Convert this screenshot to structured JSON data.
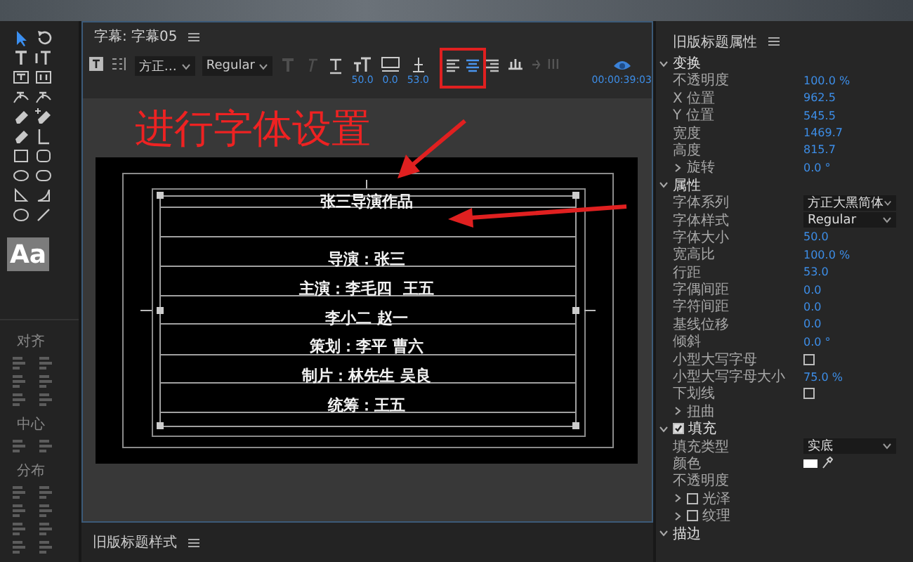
{
  "tools": [
    {
      "kind": "selection",
      "selected": true
    },
    {
      "kind": "rotation",
      "selected": false
    },
    {
      "kind": "type",
      "selected": false
    },
    {
      "kind": "vertical-type",
      "selected": false
    },
    {
      "kind": "area-type",
      "selected": false
    },
    {
      "kind": "vertical-area-type",
      "selected": false
    },
    {
      "kind": "path-type",
      "selected": false
    },
    {
      "kind": "vertical-path-type",
      "selected": false
    },
    {
      "kind": "pen",
      "selected": false
    },
    {
      "kind": "add-anchor",
      "selected": false
    },
    {
      "kind": "delete-anchor",
      "selected": false
    },
    {
      "kind": "convert-anchor",
      "selected": false
    },
    {
      "kind": "rectangle",
      "selected": false
    },
    {
      "kind": "rounded-rectangle",
      "selected": false
    },
    {
      "kind": "ellipse",
      "selected": false
    },
    {
      "kind": "rounded-ellipse",
      "selected": false
    },
    {
      "kind": "wedge",
      "selected": false
    },
    {
      "kind": "arc",
      "selected": false
    },
    {
      "kind": "circle",
      "selected": false
    },
    {
      "kind": "line",
      "selected": false
    }
  ],
  "style_preview": "Aa",
  "tool_sections": [
    {
      "label": "对齐"
    },
    {
      "label": "中心"
    },
    {
      "label": "分布"
    }
  ],
  "title_panel": {
    "title": "字幕: 字幕05",
    "toolbar": {
      "font_family": "方正…",
      "font_style": "Regular",
      "style_buttons": [
        {
          "kind": "bold",
          "disabled": true
        },
        {
          "kind": "italic",
          "disabled": true
        },
        {
          "kind": "underline",
          "disabled": false
        }
      ],
      "size": "50.0",
      "kerning": "0.0",
      "leading": "53.0",
      "alignment": [
        {
          "kind": "left",
          "selected": false
        },
        {
          "kind": "center",
          "selected": true
        },
        {
          "kind": "right",
          "selected": false
        }
      ],
      "timecode": "00:00:39:03"
    },
    "canvas": {
      "title_text": "张三导演作品",
      "credits": [
        "导演：张三",
        "主演：李毛四  王五",
        "李小二 赵一",
        "策划：李平 曹六",
        "制片：林先生 吴良",
        "统筹：王五"
      ]
    }
  },
  "styles_panel": {
    "title": "旧版标题样式"
  },
  "properties_panel": {
    "title": "旧版标题属性",
    "rows": [
      {
        "kind": "section",
        "label": "变换",
        "expanded": true
      },
      {
        "kind": "value",
        "label": "不透明度",
        "value": "100.0 %"
      },
      {
        "kind": "value",
        "label": "X 位置",
        "value": "962.5"
      },
      {
        "kind": "value",
        "label": "Y 位置",
        "value": "545.5"
      },
      {
        "kind": "value",
        "label": "宽度",
        "value": "1469.7"
      },
      {
        "kind": "value",
        "label": "高度",
        "value": "815.7"
      },
      {
        "kind": "group",
        "label": "旋转",
        "expanded": false,
        "value": "0.0 °"
      },
      {
        "kind": "section",
        "label": "属性",
        "expanded": true
      },
      {
        "kind": "dropdown",
        "label": "字体系列",
        "value": "方正大黑简体"
      },
      {
        "kind": "dropdown",
        "label": "字体样式",
        "value": "Regular"
      },
      {
        "kind": "value",
        "label": "字体大小",
        "value": "50.0"
      },
      {
        "kind": "value",
        "label": "宽高比",
        "value": "100.0 %"
      },
      {
        "kind": "value",
        "label": "行距",
        "value": "53.0"
      },
      {
        "kind": "value",
        "label": "字偶间距",
        "value": "0.0"
      },
      {
        "kind": "value",
        "label": "字符间距",
        "value": "0.0"
      },
      {
        "kind": "value",
        "label": "基线位移",
        "value": "0.0"
      },
      {
        "kind": "value",
        "label": "倾斜",
        "value": "0.0 °"
      },
      {
        "kind": "checkbox",
        "label": "小型大写字母",
        "checked": false
      },
      {
        "kind": "value",
        "label": "小型大写字母大小",
        "value": "75.0 %"
      },
      {
        "kind": "checkbox",
        "label": "下划线",
        "checked": false
      },
      {
        "kind": "group",
        "label": "扭曲",
        "expanded": false
      },
      {
        "kind": "section",
        "label": "填充",
        "expanded": true,
        "checked": true
      },
      {
        "kind": "dropdown",
        "label": "填充类型",
        "value": "实底"
      },
      {
        "kind": "color",
        "label": "颜色",
        "color": "#ffffff"
      },
      {
        "kind": "label",
        "label": "不透明度"
      },
      {
        "kind": "group",
        "label": "光泽",
        "expanded": false,
        "checked": false
      },
      {
        "kind": "group",
        "label": "纹理",
        "expanded": false,
        "checked": false
      },
      {
        "kind": "section",
        "label": "描边",
        "expanded": true
      }
    ]
  },
  "annotation": {
    "text": "进行字体设置"
  }
}
